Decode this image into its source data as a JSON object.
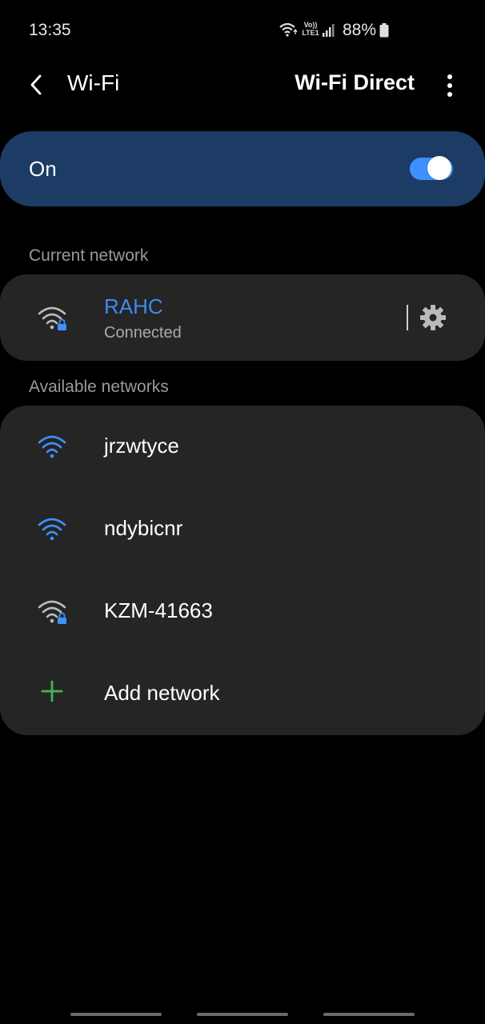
{
  "status": {
    "time": "13:35",
    "volte": "Vo))",
    "lte": "LTE1",
    "battery": "88%"
  },
  "header": {
    "title": "Wi-Fi",
    "wifi_direct": "Wi-Fi Direct"
  },
  "toggle": {
    "label": "On",
    "state": "on"
  },
  "current": {
    "section_label": "Current network",
    "name": "RAHC",
    "status": "Connected",
    "secured": true
  },
  "available": {
    "section_label": "Available networks",
    "networks": [
      {
        "name": "jrzwtyce",
        "secured": false
      },
      {
        "name": "ndybicnr",
        "secured": false
      },
      {
        "name": "KZM-41663",
        "secured": true
      }
    ],
    "add_label": "Add network"
  },
  "colors": {
    "accent": "#3e91ff",
    "toggle_card": "#1c3c66",
    "card": "#252525",
    "add_icon": "#3fb65b"
  }
}
